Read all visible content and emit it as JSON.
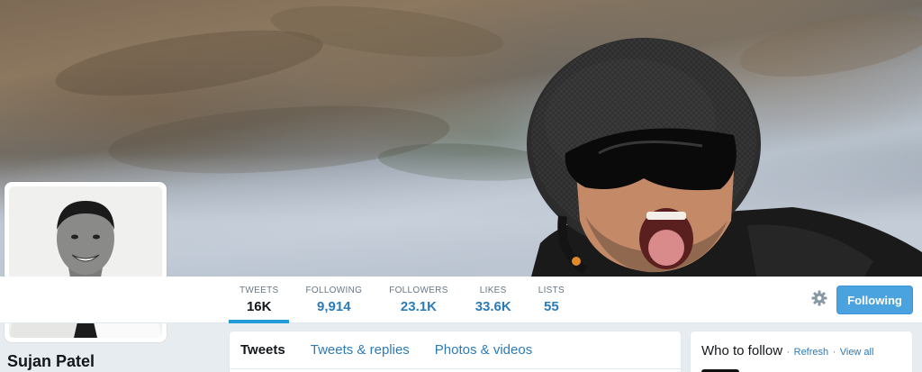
{
  "profile": {
    "name": "Sujan Patel"
  },
  "stats": [
    {
      "label": "TWEETS",
      "value": "16K"
    },
    {
      "label": "FOLLOWING",
      "value": "9,914"
    },
    {
      "label": "FOLLOWERS",
      "value": "23.1K"
    },
    {
      "label": "LIKES",
      "value": "33.6K"
    },
    {
      "label": "LISTS",
      "value": "55"
    }
  ],
  "actions": {
    "follow_label": "Following",
    "settings_icon": "gear-icon"
  },
  "timeline_tabs": [
    "Tweets",
    "Tweets & replies",
    "Photos & videos"
  ],
  "who_to_follow": {
    "title": "Who to follow",
    "separator": "·",
    "refresh": "Refresh",
    "view_all": "View all"
  },
  "colors": {
    "accent": "#2b7bb9",
    "follow_button": "#4aa3df",
    "active_tab_underline": "#229bd8"
  }
}
